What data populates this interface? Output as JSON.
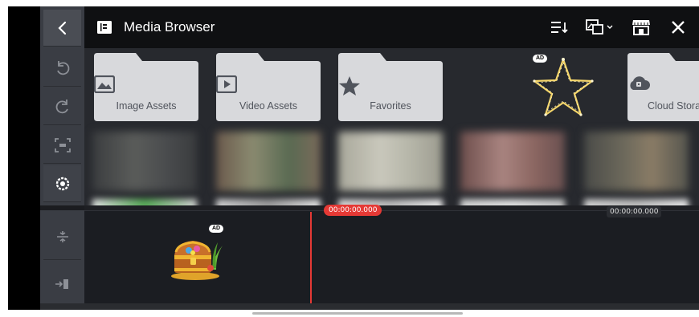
{
  "header": {
    "title": "Media Browser"
  },
  "folders": [
    {
      "label": "Image Assets",
      "icon": "image-icon"
    },
    {
      "label": "Video Assets",
      "icon": "video-icon"
    },
    {
      "label": "Favorites",
      "icon": "star-icon"
    },
    {
      "label": "Cloud Storage",
      "icon": "cloud-icon"
    }
  ],
  "ads": {
    "star_badge": "AD",
    "chest_badge": "AD"
  },
  "timeline": {
    "playhead_time": "00:00:00.000",
    "end_time": "00:00:00.000"
  },
  "colors": {
    "accent_red": "#e53935",
    "rail_bg": "#3a3d44",
    "header_bg": "#0f1012",
    "folder_bg": "#d8d9dc"
  }
}
